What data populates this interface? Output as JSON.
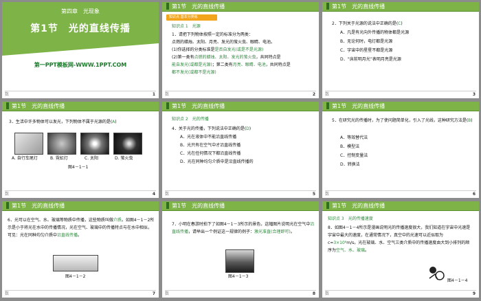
{
  "header_title": "第1节　光的直线传播",
  "footer_logo": "数",
  "slide1": {
    "chapter": "第四章　光现象",
    "section": "第1节　光的直线传播",
    "site": "第一PPT模板网-WWW.1PPT.COM",
    "page": "1"
  },
  "slide2": {
    "badge": "知识点 基本分类练",
    "kp": "知识点 1　光源",
    "q": "1．请把下列物体按照一定的标准分为两类：",
    "items": "点燃的蜡烛、太阳、月亮、发光的萤火虫、眼睛、电池。",
    "l1": "(1)你选择的分类标准是",
    "a1": "是否自发光(或是不是光源)",
    "l2a": "(2)第一类有",
    "a2a": "点燃的蜡烛、太阳、发光的萤火虫",
    "l2b": "，共同特点是",
    "a2b": "能自发光(或都是光源)",
    "l2c": "；第二类有",
    "a2c": "月亮、眼睛、电池",
    "l2d": "，共同特点是",
    "a2d": "都不发光(或都不是光源)",
    "page": "2"
  },
  "slide3": {
    "q": "2．下列关于光源的说法中正确的是(",
    "ans": "C",
    "qend": ")",
    "options": [
      "A．凡是有光向外传播的物体都是光源",
      "B．无论何时，电灯都是光源",
      "C．宇宙中的星星不都是光源",
      "D．“床前明月光”表明月亮是光源"
    ],
    "page": "3"
  },
  "slide4": {
    "q": "3．生活中许多物体可以发光，下列物体不属于光源的是(",
    "ans": "A",
    "qend": ")",
    "labels": [
      "A. 自行车尾灯",
      "B. 霓虹灯",
      "C. 太阳",
      "D. 萤火虫"
    ],
    "fig": "图4－1－1",
    "page": "4"
  },
  "slide5": {
    "kp": "知识点 2　光的传播",
    "q": "4．关于光的传播，下列说法中正确的是(",
    "ans": "D",
    "qend": ")",
    "options": [
      "A．光在液体中不能沿直线传播",
      "B．光只有在空气中才沿直线传播",
      "C．光在任何情况下都沿直线传播",
      "D．光在同种均匀介质中是沿直线传播的"
    ],
    "page": "5"
  },
  "slide6": {
    "q": "5．在研究光的传播时，为了使问题简单化，引入了光线，这种研究方法是(",
    "ans": "B",
    "qend": ")",
    "options": [
      "A．等效替代法",
      "B．模型法",
      "C．控制变量法",
      "D．转换法"
    ],
    "page": "6"
  },
  "slide7": {
    "t1": "6．光可以在空气、水、玻璃等物质中传播，这些物质叫做",
    "a1": "介质",
    "t2": "。如图4－1－2所示是小于将光在水中的传播情况，光在空气、玻璃中的传播特点与在水中相似，可见：光在同种均匀介质中",
    "a2": "沿直线传播",
    "t3": "。",
    "fig": "图4－1－2",
    "page": "7"
  },
  "slide8": {
    "t1": "7．小明在春游时拍下了如图4－1－3所示的景色，这幅图片说明光在空气中",
    "a1": "沿直线传播",
    "t2": "，请举出一个例证这一规律的例子：",
    "a2": "激光准直(合理即可)",
    "t3": "。",
    "fig": "图4－1－3",
    "page": "8"
  },
  "slide9": {
    "kp": "知识点 3　光的传播速度",
    "t1": "8．如图4－1－4所示是漫画说明光的传播速度很大，我们知道在宇宙中光速是宇宙中最大的速度，在通常情况下，真空中的光速可以近似取为c=",
    "a1": "3×10⁸",
    "t2": "m/s。光在玻璃、水、空气三类介质中的传播速度由大到小排列的顺序为",
    "a2": "空气、水、玻璃",
    "t3": "。",
    "fig": "图4－1－4",
    "page": "9"
  }
}
